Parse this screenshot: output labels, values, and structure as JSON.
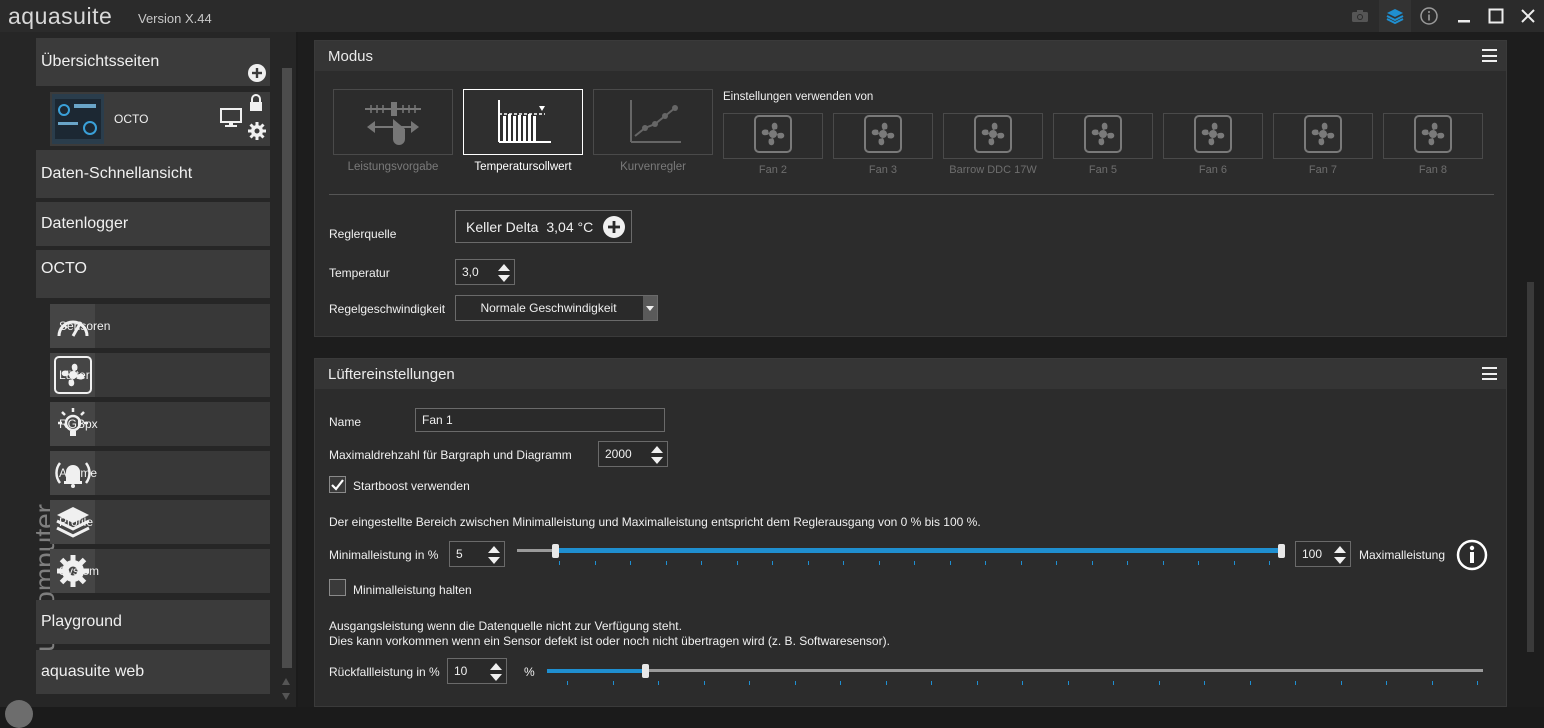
{
  "app": {
    "logo": "aquasuite",
    "version": "Version X.44",
    "brand": "aquacomputer"
  },
  "titlebar_icons": [
    "camera-icon",
    "layers-icon",
    "info-icon",
    "minimize-icon",
    "maximize-icon",
    "close-icon"
  ],
  "sidebar": {
    "overview": "Übersichtsseiten",
    "device_tile": "OCTO",
    "quickview": "Daten-Schnellansicht",
    "datalogger": "Datenlogger",
    "device": "OCTO",
    "subitems": [
      {
        "label": "Sensoren",
        "icon": "gauge-icon"
      },
      {
        "label": "Lüfter",
        "icon": "fan-icon"
      },
      {
        "label": "RGBpx",
        "icon": "lightbulb-icon"
      },
      {
        "label": "Alarme",
        "icon": "alarm-bell-icon"
      },
      {
        "label": "Profile",
        "icon": "layers-icon"
      },
      {
        "label": "System",
        "icon": "gear-icon"
      }
    ],
    "playground": "Playground",
    "web": "aquasuite web"
  },
  "modus": {
    "title": "Modus",
    "modes": [
      {
        "label": "Leistungsvorgabe",
        "active": false
      },
      {
        "label": "Temperatursollwert",
        "active": true
      },
      {
        "label": "Kurvenregler",
        "active": false
      }
    ],
    "settings_from_label": "Einstellungen verwenden von",
    "fans": [
      "Fan 2",
      "Fan 3",
      "Barrow DDC 17W",
      "Fan 5",
      "Fan 6",
      "Fan 7",
      "Fan 8"
    ],
    "source_label": "Reglerquelle",
    "source_name": "Keller Delta",
    "source_value": "3,04 °C",
    "temp_label": "Temperatur",
    "temp_value": "3,0",
    "speed_label": "Regelgeschwindigkeit",
    "speed_value": "Normale Geschwindigkeit"
  },
  "fan_settings": {
    "title": "Lüftereinstellungen",
    "name_label": "Name",
    "name_value": "Fan 1",
    "maxrpm_label": "Maximaldrehzahl für Bargraph und Diagramm",
    "maxrpm_value": "2000",
    "startboost_label": "Startboost verwenden",
    "startboost_checked": true,
    "range_note": "Der eingestellte Bereich zwischen Minimalleistung und Maximalleistung entspricht dem Reglerausgang von 0 % bis 100 %.",
    "min_label": "Minimalleistung in %",
    "min_value": "5",
    "max_value": "100",
    "max_label": "Maximalleistung",
    "hold_min_label": "Minimalleistung halten",
    "hold_min_checked": false,
    "fallback_note_1": "Ausgangsleistung wenn die Datenquelle nicht zur Verfügung steht.",
    "fallback_note_2": "Dies kann vorkommen wenn ein Sensor defekt ist oder noch nicht übertragen wird (z. B. Softwaresensor).",
    "fallback_label": "Rückfallleistung in %",
    "fallback_value": "10",
    "fallback_unit": "%",
    "range_min_fraction": 0.05,
    "range_max_fraction": 1.0,
    "fallback_fraction": 0.1
  },
  "colors": {
    "accent": "#1f8fd0",
    "panel": "#2c2c2c",
    "header": "#353535"
  }
}
